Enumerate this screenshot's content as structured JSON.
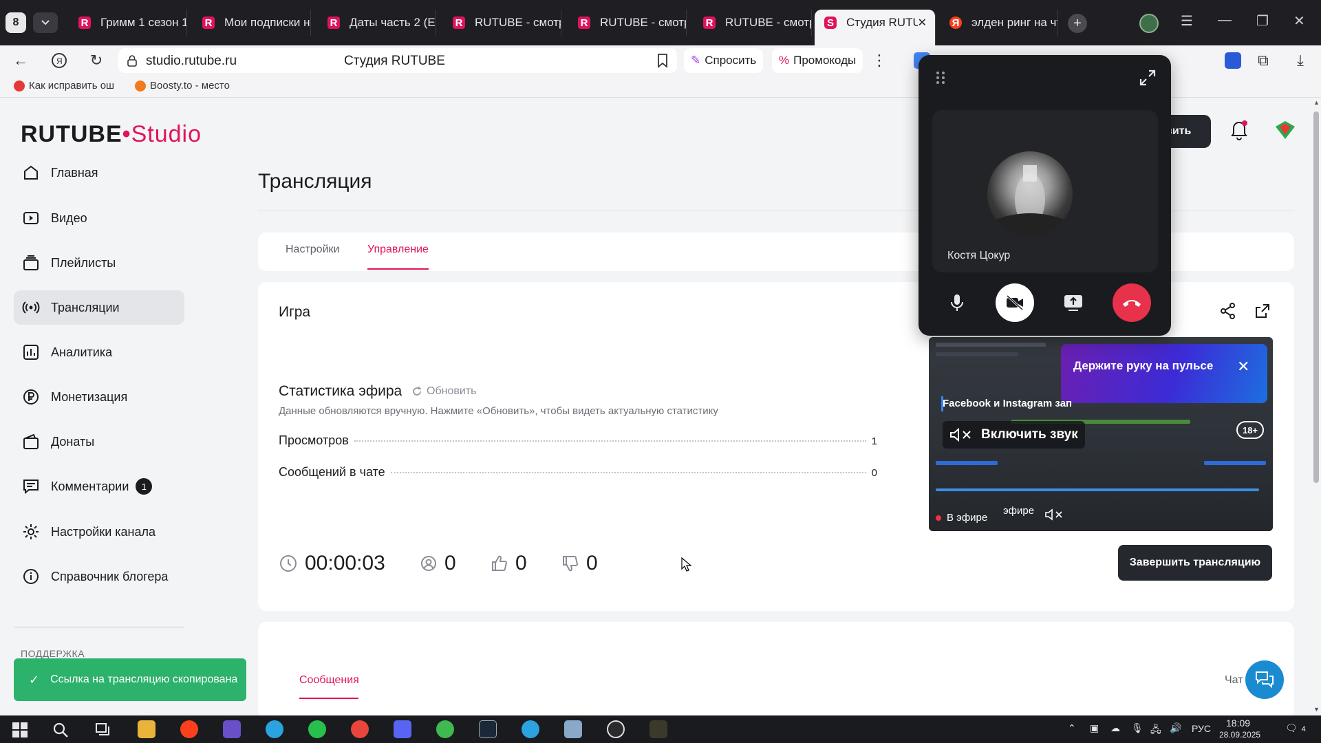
{
  "browser": {
    "tab_count": "8",
    "tabs": [
      {
        "label": "Гримм 1 сезон 1",
        "favicon": "rutube"
      },
      {
        "label": "Мои подписки н",
        "favicon": "rutube"
      },
      {
        "label": "Даты часть 2 (Ес",
        "favicon": "rutube"
      },
      {
        "label": "RUTUBE - смотр",
        "favicon": "rutube"
      },
      {
        "label": "RUTUBE - смотр",
        "favicon": "rutube"
      },
      {
        "label": "RUTUBE - смотр",
        "favicon": "rutube"
      },
      {
        "label": "Студия RUTU",
        "favicon": "studio",
        "active": true
      },
      {
        "label": "элден ринг на чт",
        "favicon": "yandex"
      }
    ],
    "url": "studio.rutube.ru",
    "page_title": "Студия RUTUBE",
    "ask_label": "Спросить",
    "promo_label": "Промокоды",
    "bookmarks": [
      "Как исправить ош",
      "Boosty.to - место"
    ]
  },
  "logo": {
    "left": "RUTUBE",
    "right": "Studio"
  },
  "sidebar": {
    "items": [
      {
        "label": "Главная",
        "icon": "home-icon"
      },
      {
        "label": "Видео",
        "icon": "video-icon"
      },
      {
        "label": "Плейлисты",
        "icon": "playlist-icon"
      },
      {
        "label": "Трансляции",
        "icon": "broadcast-icon",
        "active": true
      },
      {
        "label": "Аналитика",
        "icon": "analytics-icon"
      },
      {
        "label": "Монетизация",
        "icon": "ruble-icon"
      },
      {
        "label": "Донаты",
        "icon": "wallet-icon"
      },
      {
        "label": "Комментарии",
        "icon": "comments-icon",
        "badge": "1"
      },
      {
        "label": "Настройки канала",
        "icon": "gear-icon"
      },
      {
        "label": "Справочник блогера",
        "icon": "info-icon"
      }
    ],
    "support_label": "ПОДДЕРЖКА"
  },
  "header": {
    "button_label": "вить"
  },
  "main": {
    "title": "Трансляция",
    "tabs": [
      {
        "label": "Настройки"
      },
      {
        "label": "Управление",
        "active": true
      }
    ],
    "stream_name": "Игра",
    "stats": {
      "title": "Статистика эфира",
      "refresh_label": "Обновить",
      "hint": "Данные обновляются вручную. Нажмите «Обновить», чтобы видеть актуальную статистику",
      "rows": [
        {
          "label": "Просмотров",
          "value": "1"
        },
        {
          "label": "Сообщений в чате",
          "value": "0"
        }
      ]
    },
    "counters": {
      "duration": "00:00:03",
      "viewers": "0",
      "likes": "0",
      "dislikes": "0"
    },
    "end_button": "Завершить трансляцию"
  },
  "preview": {
    "promo_text": "Держите руку на пульсе",
    "fb_text": "Facebook и Instagram зап",
    "unmute_label": "Включить звук",
    "age_badge": "18+",
    "live_label": "В эфире",
    "live_label_2": "эфире"
  },
  "messages": {
    "tab_messages": "Сообщения",
    "tab_chat": "Чат"
  },
  "toast": {
    "text": "Ссылка на трансляцию скопирована"
  },
  "call": {
    "caller_name": "Костя Цокур"
  },
  "taskbar": {
    "lang": "РУС",
    "time": "18:09",
    "date": "28.09.2025",
    "notifications": "4"
  },
  "colors": {
    "accent": "#e0135e",
    "success": "#2cb26b",
    "dark_button": "#25282e",
    "hangup": "#e8314a"
  }
}
